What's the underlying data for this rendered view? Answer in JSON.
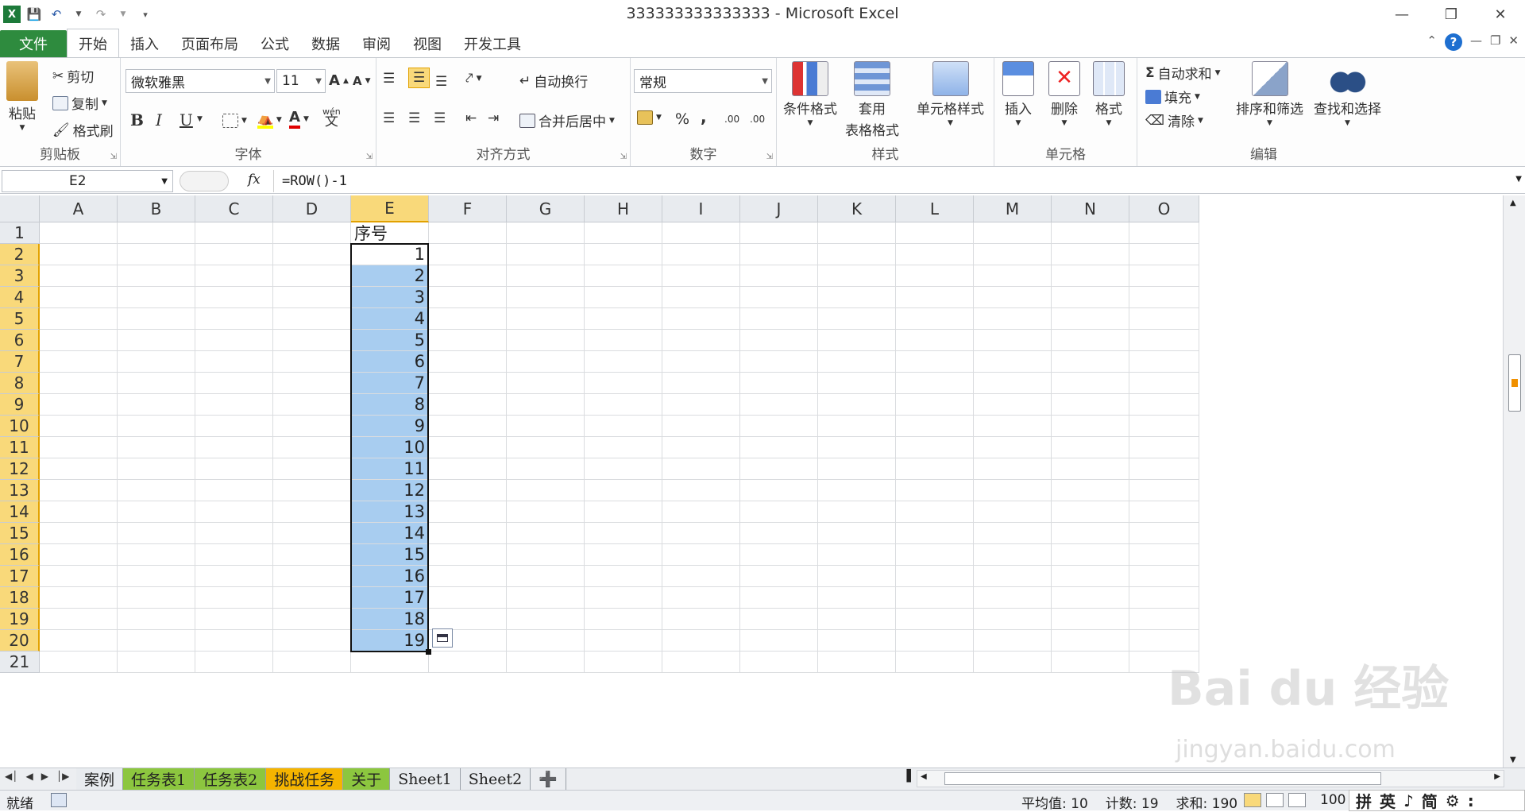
{
  "window": {
    "title": "333333333333333  -  Microsoft Excel"
  },
  "qat": {
    "save": "save-icon",
    "undo": "undo-icon",
    "redo": "redo-icon"
  },
  "tabs": [
    {
      "label": "文件"
    },
    {
      "label": "开始"
    },
    {
      "label": "插入"
    },
    {
      "label": "页面布局"
    },
    {
      "label": "公式"
    },
    {
      "label": "数据"
    },
    {
      "label": "审阅"
    },
    {
      "label": "视图"
    },
    {
      "label": "开发工具"
    }
  ],
  "ribbon": {
    "clipboard": {
      "label": "剪贴板",
      "paste": "粘贴",
      "cut": "剪切",
      "copy": "复制",
      "format_painter": "格式刷"
    },
    "font": {
      "label": "字体",
      "font_name": "微软雅黑",
      "font_size": "11",
      "bold": "B",
      "italic": "I",
      "underline": "U",
      "wen": "wén"
    },
    "alignment": {
      "label": "对齐方式",
      "wrap": "自动换行",
      "merge": "合并后居中"
    },
    "number": {
      "label": "数字",
      "format": "常规",
      "percent": "%",
      "comma": ",",
      "inc_dec": ".00",
      "dec_dec": ".00"
    },
    "styles": {
      "label": "样式",
      "conditional": "条件格式",
      "table1": "套用",
      "table2": "表格格式",
      "cell_styles": "单元格样式"
    },
    "cells": {
      "label": "单元格",
      "insert": "插入",
      "delete": "删除",
      "format": "格式"
    },
    "editing": {
      "label": "编辑",
      "autosum": "自动求和",
      "fill": "填充",
      "clear": "清除",
      "sort": "排序和筛选",
      "find": "查找和选择"
    }
  },
  "formula_bar": {
    "name_box": "E2",
    "fx": "fx",
    "formula": "=ROW()-1"
  },
  "columns": [
    "A",
    "B",
    "C",
    "D",
    "E",
    "F",
    "G",
    "H",
    "I",
    "J",
    "K",
    "L",
    "M",
    "N",
    "O"
  ],
  "rows": [
    "1",
    "2",
    "3",
    "4",
    "5",
    "6",
    "7",
    "8",
    "9",
    "10",
    "11",
    "12",
    "13",
    "14",
    "15",
    "16",
    "17",
    "18",
    "19",
    "20",
    "21"
  ],
  "cells": {
    "header": "序号",
    "values": [
      "1",
      "2",
      "3",
      "4",
      "5",
      "6",
      "7",
      "8",
      "9",
      "10",
      "11",
      "12",
      "13",
      "14",
      "15",
      "16",
      "17",
      "18",
      "19"
    ]
  },
  "sheets": [
    {
      "name": "案例",
      "color": "#e8ebef"
    },
    {
      "name": "任务表1",
      "color": "#8cc63f"
    },
    {
      "name": "任务表2",
      "color": "#8cc63f"
    },
    {
      "name": "挑战任务",
      "color": "#f5b400"
    },
    {
      "name": "关于",
      "color": "#8cc63f"
    },
    {
      "name": "Sheet1",
      "color": "#e8ebef"
    },
    {
      "name": "Sheet2",
      "color": "#e8ebef"
    }
  ],
  "status": {
    "ready": "就绪",
    "average": "平均值: 10",
    "count": "计数: 19",
    "sum": "求和: 190",
    "zoom": "100",
    "ime": [
      "拼",
      "英",
      "♪",
      "简",
      "⚙",
      ":"
    ]
  },
  "colors": {
    "file_tab": "#2e8b3e",
    "selection": "#a8cdf0",
    "header_selected": "#f9d97a"
  },
  "watermark": {
    "brand": "Bai du 经验",
    "url": "jingyan.baidu.com"
  }
}
